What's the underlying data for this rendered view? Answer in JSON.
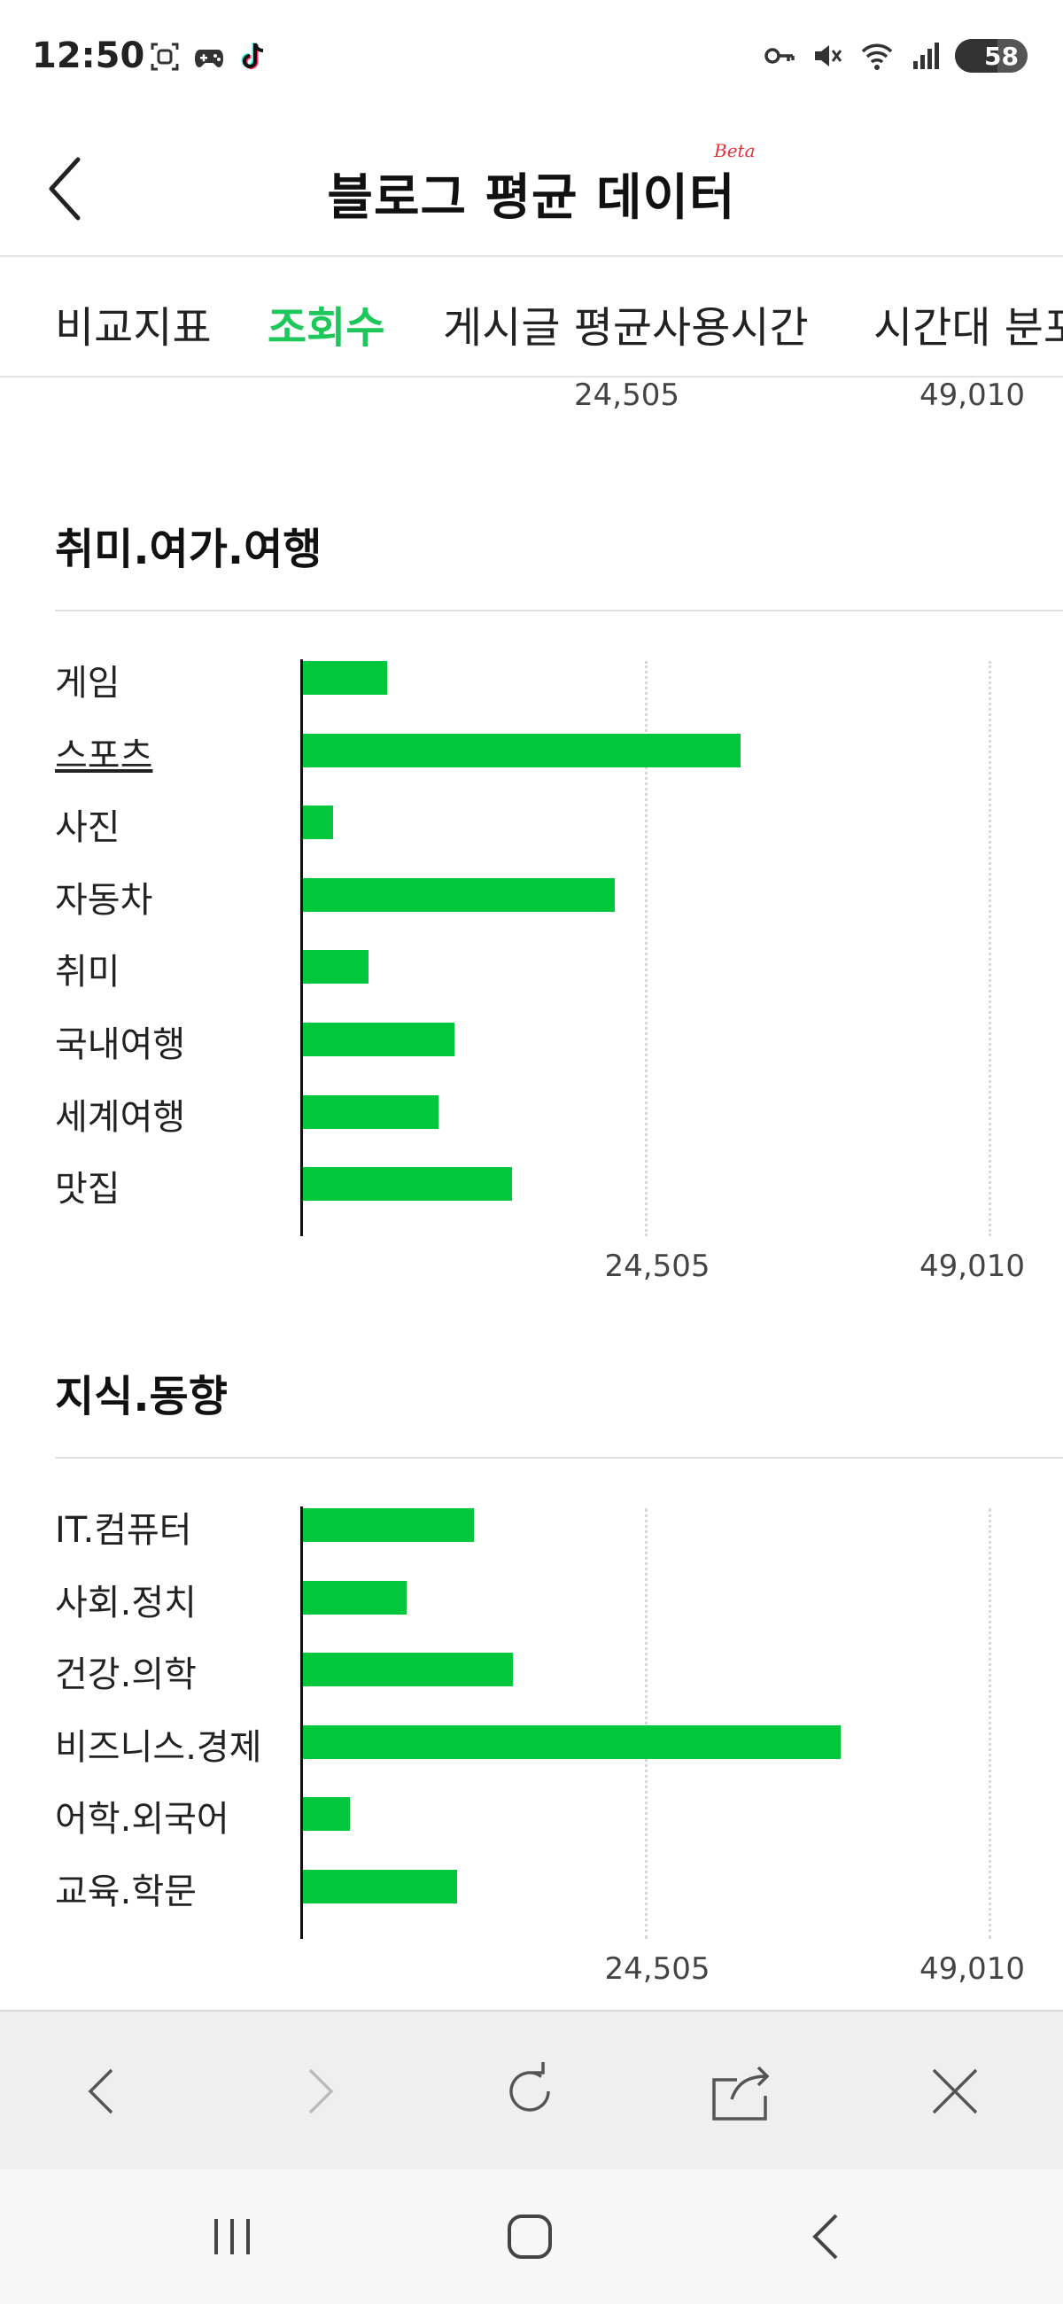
{
  "status_bar": {
    "time": "12:50",
    "battery": "58",
    "battery_level": 0.58,
    "left_icons": [
      "screenshot-icon",
      "game-controller-icon",
      "tiktok-icon"
    ],
    "right_icons": [
      "key-icon",
      "mute-icon",
      "wifi-icon",
      "signal-icon",
      "battery-icon"
    ]
  },
  "header": {
    "title": "블로그 평균 데이터",
    "beta": "Beta",
    "back_icon": "chevron-left-icon"
  },
  "tabs": [
    {
      "label": "비교지표",
      "active": false
    },
    {
      "label": "조회수",
      "active": true
    },
    {
      "label": "게시글 평균사용시간",
      "active": false
    },
    {
      "label": "시간대 분포",
      "active": false
    }
  ],
  "axis": {
    "mid_label": "24,505",
    "max_label": "49,010",
    "max": 49010,
    "mid": 24505
  },
  "sections": [
    {
      "title": "취미.여가.여행",
      "categories": [
        {
          "label": "게임",
          "value": 6100
        },
        {
          "label": "스포츠",
          "value": 31300,
          "underline": true
        },
        {
          "label": "사진",
          "value": 2300
        },
        {
          "label": "자동차",
          "value": 22300
        },
        {
          "label": "취미",
          "value": 4800
        },
        {
          "label": "국내여행",
          "value": 10900
        },
        {
          "label": "세계여행",
          "value": 9800
        },
        {
          "label": "맛집",
          "value": 15000
        }
      ]
    },
    {
      "title": "지식.동향",
      "categories": [
        {
          "label": "IT.컴퓨터",
          "value": 12300
        },
        {
          "label": "사회.정치",
          "value": 7500
        },
        {
          "label": "건강.의학",
          "value": 15100
        },
        {
          "label": "비즈니스.경제",
          "value": 38400
        },
        {
          "label": "어학.외국어",
          "value": 3500
        },
        {
          "label": "교육.학문",
          "value": 11100
        }
      ]
    }
  ],
  "chart_data": [
    {
      "type": "bar",
      "title": "취미.여가.여행",
      "categories": [
        "게임",
        "스포츠",
        "사진",
        "자동차",
        "취미",
        "국내여행",
        "세계여행",
        "맛집"
      ],
      "values": [
        6100,
        31300,
        2300,
        22300,
        4800,
        10900,
        9800,
        15000
      ],
      "xlim": [
        0,
        49010
      ],
      "xticks": [
        "24,505",
        "49,010"
      ],
      "orientation": "horizontal",
      "color": "#00c73c"
    },
    {
      "type": "bar",
      "title": "지식.동향",
      "categories": [
        "IT.컴퓨터",
        "사회.정치",
        "건강.의학",
        "비즈니스.경제",
        "어학.외국어",
        "교육.학문"
      ],
      "values": [
        12300,
        7500,
        15100,
        38400,
        3500,
        11100
      ],
      "xlim": [
        0,
        49010
      ],
      "xticks": [
        "24,505",
        "49,010"
      ],
      "orientation": "horizontal",
      "color": "#00c73c"
    }
  ],
  "browser_bar": {
    "buttons": [
      "back-icon",
      "forward-icon",
      "reload-icon",
      "share-icon",
      "close-icon"
    ]
  },
  "system_nav": {
    "buttons": [
      "recents-icon",
      "home-icon",
      "back-icon"
    ]
  },
  "colors": {
    "accent": "#1ec75a",
    "bar": "#00c73c",
    "beta": "#e0323c"
  }
}
